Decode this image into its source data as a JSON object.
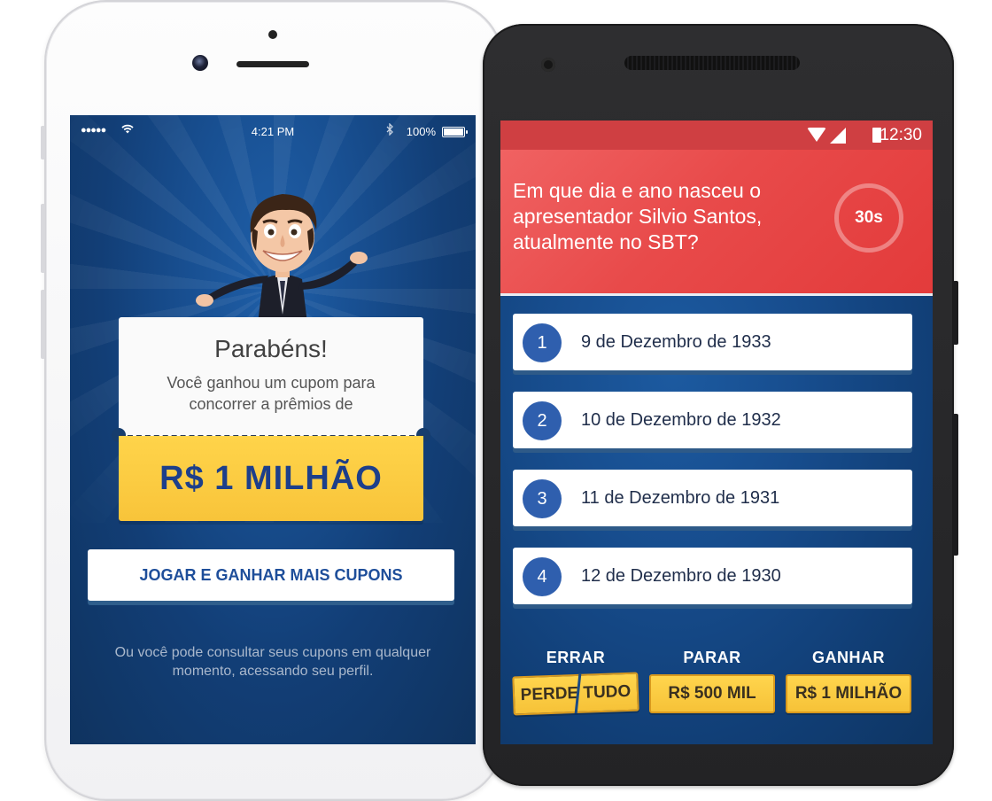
{
  "ios": {
    "status": {
      "signal": "●●●●●",
      "wifi_icon": "wifi-icon",
      "time": "4:21 PM",
      "bluetooth_icon": "bluetooth-icon",
      "battery": "100%"
    },
    "ticket": {
      "title": "Parabéns!",
      "subtitle": "Você ganhou um cupom para concorrer a prêmios de",
      "prize": "R$ 1 MILHÃO"
    },
    "cta_label": "JOGAR E GANHAR MAIS CUPONS",
    "footnote": "Ou você pode consultar seus cupons em qualquer momento, acessando seu perfil."
  },
  "android": {
    "status": {
      "time": "12:30"
    },
    "question": "Em que dia e ano nasceu o apresentador Silvio Santos, atualmente no SBT?",
    "timer": "30s",
    "options": [
      {
        "num": "1",
        "label": "9 de Dezembro de 1933"
      },
      {
        "num": "2",
        "label": "10 de Dezembro de 1932"
      },
      {
        "num": "3",
        "label": "11 de Dezembro de 1931"
      },
      {
        "num": "4",
        "label": "12 de Dezembro de 1930"
      }
    ],
    "stakes": [
      {
        "head": "ERRAR",
        "value": "PERDE TUDO"
      },
      {
        "head": "PARAR",
        "value": "R$ 500 MIL"
      },
      {
        "head": "GANHAR",
        "value": "R$ 1 MILHÃO"
      }
    ]
  },
  "colors": {
    "ios_bg": "#184f91",
    "ticket_yellow": "#ffd44a",
    "prize_text": "#1d3f8a",
    "question_red": "#e84a4a",
    "android_status": "#cf3f42",
    "option_number_bg": "#2f5fae",
    "stake_yellow": "#f6c238"
  }
}
